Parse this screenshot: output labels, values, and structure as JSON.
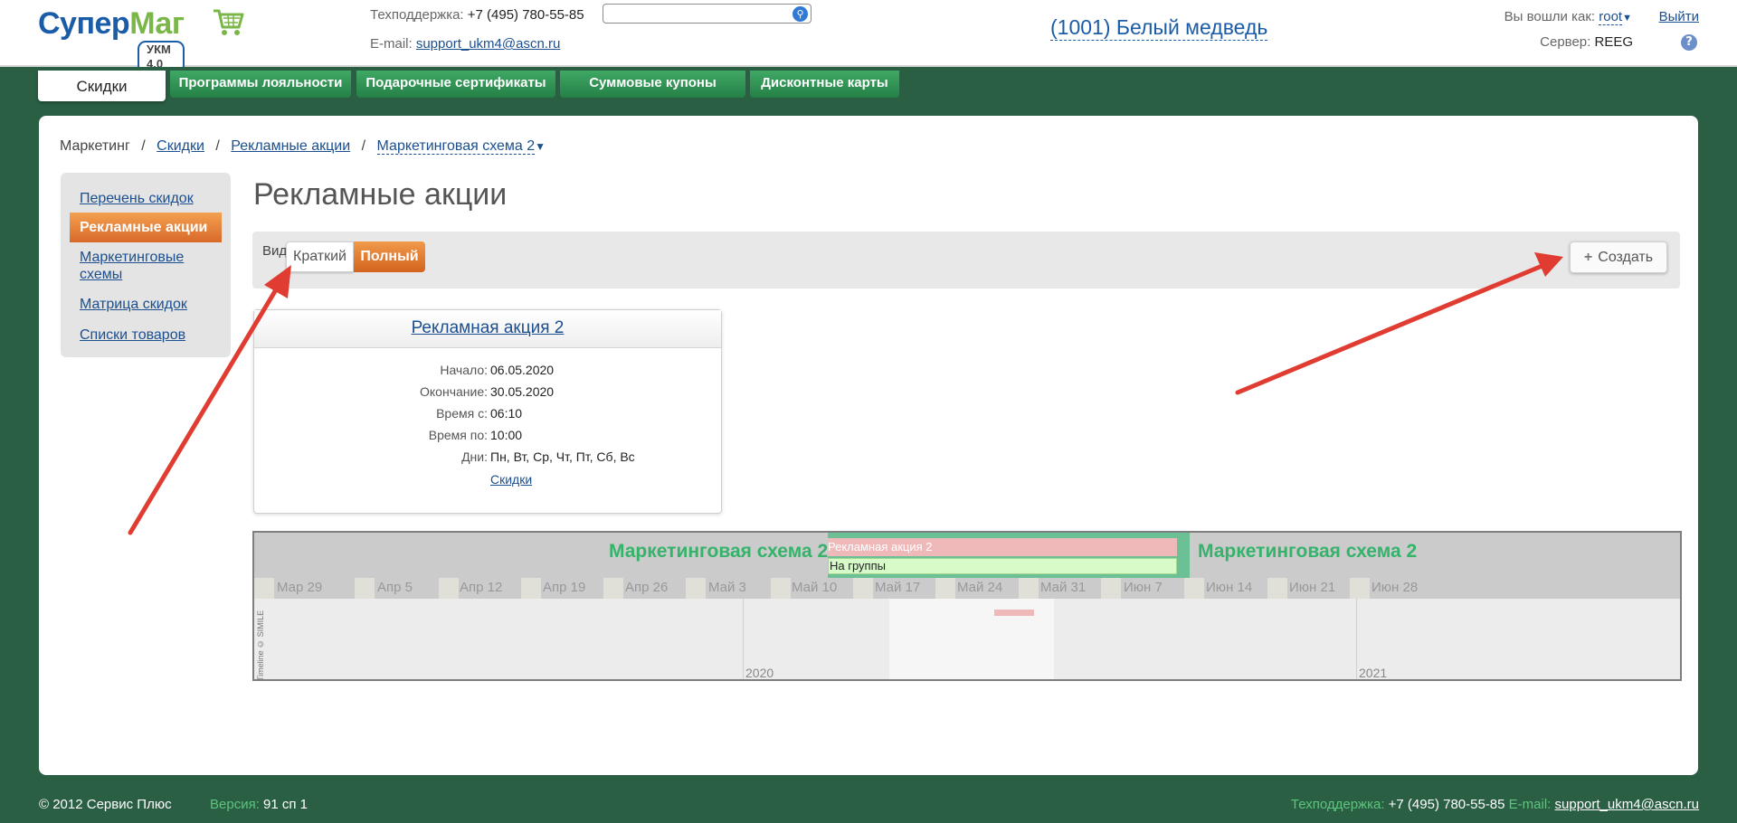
{
  "header": {
    "logo_part1": "Супер",
    "logo_part2": "Маг",
    "logo_badge": "УКМ 4.0",
    "support_label": "Техподдержка:",
    "support_phone": "+7 (495) 780-55-85",
    "email_label": "E-mail:",
    "email": "support_ukm4@ascn.ru",
    "search_placeholder": "",
    "store": "(1001) Белый медведь",
    "logged_in_label": "Вы вошли как:",
    "user": "root",
    "logout": "Выйти",
    "server_label": "Сервер:",
    "server": "REEG",
    "help": "?"
  },
  "tabs": [
    {
      "label": "Скидки",
      "active": true
    },
    {
      "label": "Программы лояльности"
    },
    {
      "label": "Подарочные сертификаты"
    },
    {
      "label": "Суммовые купоны"
    },
    {
      "label": "Дисконтные карты"
    }
  ],
  "breadcrumb": [
    "Маркетинг",
    "Скидки",
    "Рекламные акции",
    "Маркетинговая схема 2"
  ],
  "sidebar": [
    {
      "label": "Перечень скидок"
    },
    {
      "label": "Рекламные акции",
      "active": true
    },
    {
      "label": "Маркетинговые схемы"
    },
    {
      "label": "Матрица скидок"
    },
    {
      "label": "Списки товаров"
    }
  ],
  "page_title": "Рекламные акции",
  "toolbar": {
    "view_label": "Вид:",
    "short": "Краткий",
    "full": "Полный",
    "create": "Создать"
  },
  "action": {
    "title": "Рекламная акция 2",
    "fields": [
      {
        "key": "Начало:",
        "value": "06.05.2020"
      },
      {
        "key": "Окончание:",
        "value": "30.05.2020"
      },
      {
        "key": "Время с:",
        "value": "06:10"
      },
      {
        "key": "Время по:",
        "value": "10:00"
      },
      {
        "key": "Дни:",
        "value": "Пн, Вт, Ср, Чт, Пт, Сб, Вс"
      }
    ],
    "link": "Скидки"
  },
  "timeline": {
    "scheme_label": "Маркетинговая схема 2",
    "action_label": "Рекламная акция 2",
    "group_label": "На группы",
    "weeks": [
      "Мар 29",
      "Апр 5",
      "Апр 12",
      "Апр 19",
      "Апр 26",
      "Май 3",
      "Май 10",
      "Май 17",
      "Май 24",
      "Май 31",
      "Июн 7",
      "Июн 14",
      "Июн 21",
      "Июн 28"
    ],
    "years": [
      "2020",
      "2021"
    ],
    "credit": "Timeline © SIMILE"
  },
  "footer": {
    "copyright": "© 2012 Сервис Плюс",
    "version_label": "Версия:",
    "version": "91 сп 1",
    "support_label": "Техподдержка:",
    "support_phone": "+7 (495) 780-55-85",
    "email_label": "E-mail:",
    "email": "support_ukm4@ascn.ru"
  },
  "colors": {
    "brand_green": "#2a5f44",
    "tab_green": "#3fa865",
    "accent_orange": "#d9692a",
    "link_blue": "#1b4f8f",
    "arrow_red": "#e03c31"
  }
}
